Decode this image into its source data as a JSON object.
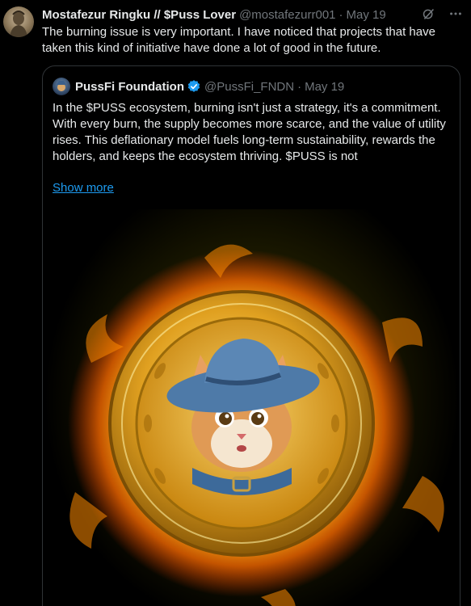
{
  "tweet": {
    "author_name": "Mostafezur Ringku // $Puss Lover",
    "handle": "@mostafezurr001",
    "separator": "·",
    "date": "May 19",
    "text": "The burning issue is very important. I have noticed that projects that have taken this kind of initiative have done a lot of good in the future."
  },
  "quoted": {
    "author_name": "PussFi Foundation",
    "verified": true,
    "handle": "@PussFi_FNDN",
    "separator": "·",
    "date": "May 19",
    "text": "In the $PUSS ecosystem, burning isn't just a strategy, it's a commitment.  With every burn, the supply becomes more scarce, and the value of utility rises. This deflationary model fuels long-term sustainability, rewards the holders, and keeps the ecosystem thriving. $PUSS is not",
    "show_more_label": "Show more"
  },
  "icons": {
    "grok": "grok-icon",
    "more": "more-options-icon",
    "verified": "verified-badge-icon"
  },
  "colors": {
    "accent": "#1d9bf0",
    "secondary_text": "#71767b",
    "border": "#2f3336"
  }
}
